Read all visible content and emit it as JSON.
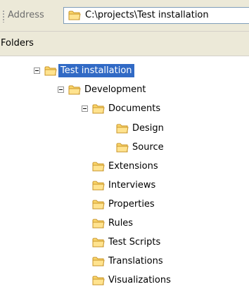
{
  "address": {
    "label": "Address",
    "path": "C:\\projects\\Test installation",
    "icon": "folder-icon"
  },
  "folders_pane": {
    "title": "Folders"
  },
  "tree": {
    "root": {
      "label": "Test installation",
      "expanded": true,
      "selected": true,
      "children": {
        "development": {
          "label": "Development",
          "expanded": true,
          "children": {
            "documents": {
              "label": "Documents",
              "expanded": true,
              "children": {
                "design": {
                  "label": "Design"
                },
                "source": {
                  "label": "Source"
                }
              }
            },
            "extensions": {
              "label": "Extensions"
            },
            "interviews": {
              "label": "Interviews"
            },
            "properties": {
              "label": "Properties"
            },
            "rules": {
              "label": "Rules"
            },
            "test_scripts": {
              "label": "Test Scripts"
            },
            "translations": {
              "label": "Translations"
            },
            "visualizations": {
              "label": "Visualizations"
            }
          }
        }
      }
    }
  },
  "colors": {
    "selection": "#316ac5",
    "folder_fill": "#fbd66b",
    "folder_outline": "#c8952a"
  }
}
